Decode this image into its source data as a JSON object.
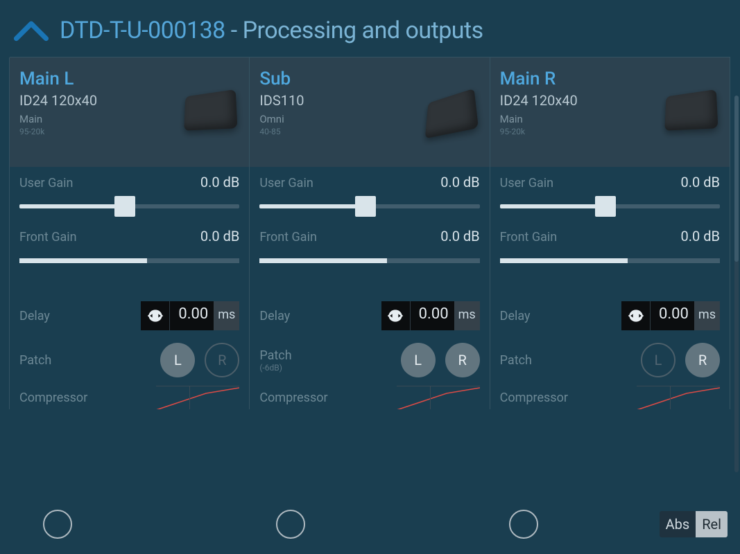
{
  "header": {
    "device_id": "DTD-T-U-000138",
    "separator": " - ",
    "page_title": "Processing and outputs"
  },
  "labels": {
    "user_gain": "User Gain",
    "front_gain": "Front Gain",
    "delay": "Delay",
    "patch": "Patch",
    "compressor": "Compressor",
    "abs": "Abs",
    "rel": "Rel",
    "L": "L",
    "R": "R"
  },
  "channels": [
    {
      "name": "Main L",
      "model": "ID24 120x40",
      "preset": "Main",
      "freq": "95-20k",
      "speaker_shape": "box",
      "user_gain_value": "0.0 dB",
      "user_gain_pos_pct": 48,
      "front_gain_value": "0.0 dB",
      "front_gain_fill_pct": 58,
      "delay_value": "0.00",
      "delay_unit": "ms",
      "patch_sub": "",
      "patch_L_active": true,
      "patch_R_active": false
    },
    {
      "name": "Sub",
      "model": "IDS110",
      "preset": "Omni",
      "freq": "40-85",
      "speaker_shape": "cube",
      "user_gain_value": "0.0 dB",
      "user_gain_pos_pct": 48,
      "front_gain_value": "0.0 dB",
      "front_gain_fill_pct": 58,
      "delay_value": "0.00",
      "delay_unit": "ms",
      "patch_sub": "(-6dB)",
      "patch_L_active": true,
      "patch_R_active": true
    },
    {
      "name": "Main R",
      "model": "ID24 120x40",
      "preset": "Main",
      "freq": "95-20k",
      "speaker_shape": "box",
      "user_gain_value": "0.0 dB",
      "user_gain_pos_pct": 48,
      "front_gain_value": "0.0 dB",
      "front_gain_fill_pct": 58,
      "delay_value": "0.00",
      "delay_unit": "ms",
      "patch_sub": "",
      "patch_L_active": false,
      "patch_R_active": true
    }
  ]
}
